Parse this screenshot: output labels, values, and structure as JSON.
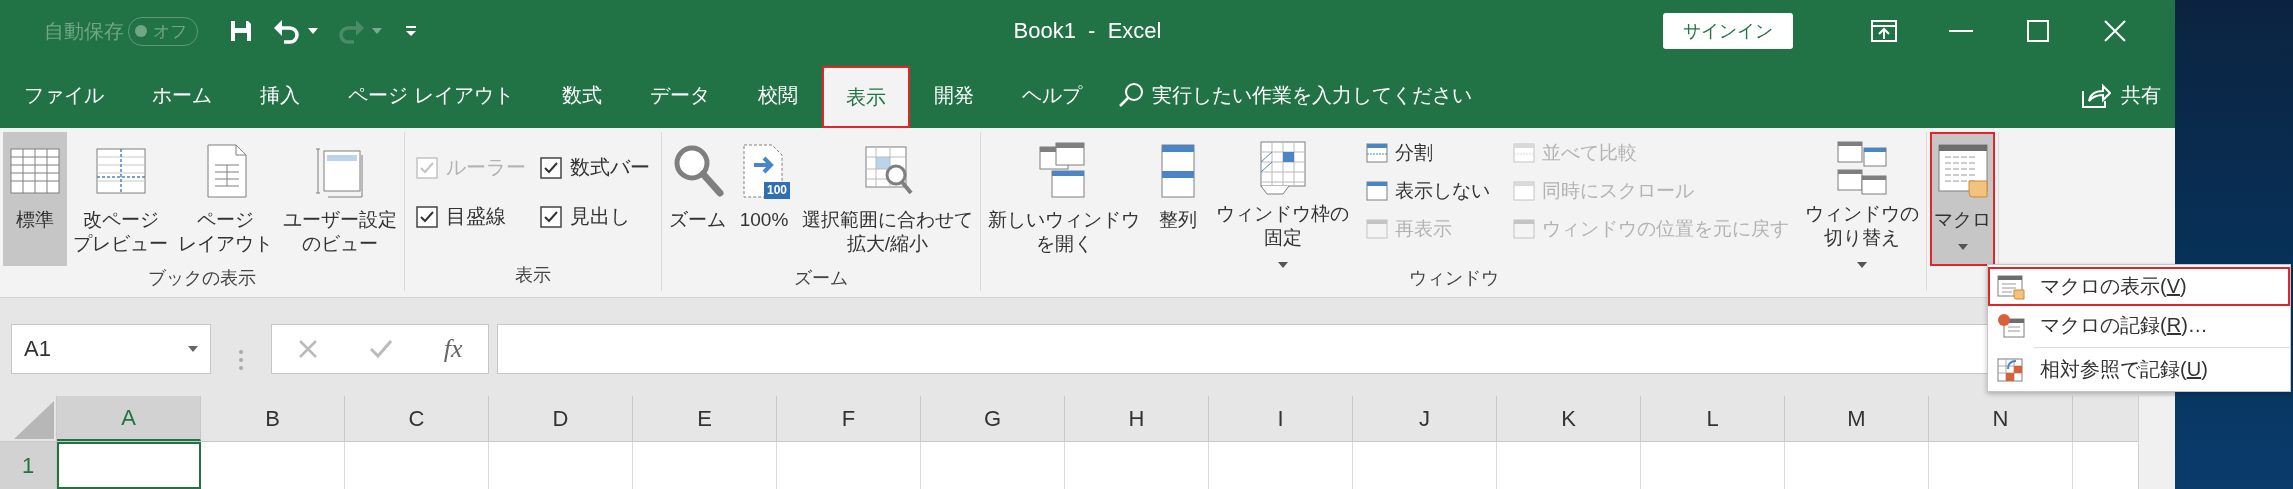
{
  "title_bar": {
    "autosave": {
      "label": "自動保存",
      "toggle": "オフ",
      "on": false
    },
    "quick_access": [
      {
        "kind": "save"
      },
      {
        "kind": "undo",
        "disabled": false
      },
      {
        "kind": "redo",
        "disabled": true
      },
      {
        "kind": "customize"
      }
    ],
    "title": "Book1  -  Excel",
    "sign_in": "サインイン"
  },
  "tabs": [
    {
      "label": "ファイル",
      "selected": false,
      "highlighted": false
    },
    {
      "label": "ホーム",
      "selected": false,
      "highlighted": false
    },
    {
      "label": "挿入",
      "selected": false,
      "highlighted": false
    },
    {
      "label": "ページ レイアウト",
      "selected": false,
      "highlighted": false
    },
    {
      "label": "数式",
      "selected": false,
      "highlighted": false
    },
    {
      "label": "データ",
      "selected": false,
      "highlighted": false
    },
    {
      "label": "校閲",
      "selected": false,
      "highlighted": false
    },
    {
      "label": "表示",
      "selected": true,
      "highlighted": true
    },
    {
      "label": "開発",
      "selected": false,
      "highlighted": false
    },
    {
      "label": "ヘルプ",
      "selected": false,
      "highlighted": false
    }
  ],
  "tell_me": {
    "placeholder": "実行したい作業を入力してください"
  },
  "share": "共有",
  "ribbon": {
    "groups": [
      {
        "label": "ブックの表示",
        "items": [
          {
            "kind": "large",
            "lines": [
              "標準"
            ],
            "selected": true
          },
          {
            "kind": "large",
            "lines": [
              "改ページ",
              "プレビュー"
            ],
            "selected": false
          },
          {
            "kind": "large",
            "lines": [
              "ページ",
              "レイアウト"
            ],
            "selected": false
          },
          {
            "kind": "large",
            "lines": [
              "ユーザー設定",
              "のビュー"
            ],
            "selected": false
          }
        ]
      },
      {
        "label": "表示",
        "items": [
          {
            "kind": "checks",
            "items": [
              {
                "label": "ルーラー",
                "checked": true,
                "disabled": true
              },
              {
                "label": "数式バー",
                "checked": true,
                "disabled": false
              },
              {
                "label": "目盛線",
                "checked": true,
                "disabled": false
              },
              {
                "label": "見出し",
                "checked": true,
                "disabled": false
              }
            ]
          }
        ]
      },
      {
        "label": "ズーム",
        "items": [
          {
            "kind": "large",
            "lines": [
              "ズーム"
            ]
          },
          {
            "kind": "large",
            "lines": [
              "100%"
            ],
            "badge": "100"
          },
          {
            "kind": "large",
            "lines": [
              "選択範囲に合わせて",
              "拡大/縮小"
            ]
          }
        ]
      },
      {
        "label": "ウィンドウ",
        "items": [
          {
            "kind": "large",
            "lines": [
              "新しいウィンドウ",
              "を開く"
            ]
          },
          {
            "kind": "large",
            "lines": [
              "整列"
            ]
          },
          {
            "kind": "large",
            "lines": [
              "ウィンドウ枠の",
              "固定"
            ],
            "dropdown": true
          },
          {
            "kind": "small",
            "items": [
              {
                "label": "分割",
                "disabled": false
              },
              {
                "label": "表示しない",
                "disabled": false
              },
              {
                "label": "再表示",
                "disabled": true
              }
            ]
          },
          {
            "kind": "small",
            "items": [
              {
                "label": "並べて比較",
                "disabled": true
              },
              {
                "label": "同時にスクロール",
                "disabled": true
              },
              {
                "label": "ウィンドウの位置を元に戻す",
                "disabled": true
              }
            ]
          },
          {
            "kind": "large",
            "lines": [
              "ウィンドウの",
              "切り替え"
            ],
            "dropdown": true
          }
        ]
      },
      {
        "items": [
          {
            "kind": "large",
            "lines": [
              "マクロ"
            ],
            "dropdown": true,
            "expanded": true,
            "highlighted": true
          }
        ]
      }
    ]
  },
  "formula_bar": {
    "name_box": "A1",
    "function_label": "fx"
  },
  "sheet": {
    "columns": [
      {
        "label": "A",
        "selected": true
      },
      {
        "label": "B",
        "selected": false
      },
      {
        "label": "C",
        "selected": false
      },
      {
        "label": "D",
        "selected": false
      },
      {
        "label": "E",
        "selected": false
      },
      {
        "label": "F",
        "selected": false
      },
      {
        "label": "G",
        "selected": false
      },
      {
        "label": "H",
        "selected": false
      },
      {
        "label": "I",
        "selected": false
      },
      {
        "label": "J",
        "selected": false
      },
      {
        "label": "K",
        "selected": false
      },
      {
        "label": "L",
        "selected": false
      },
      {
        "label": "M",
        "selected": false
      },
      {
        "label": "N",
        "selected": false
      }
    ],
    "rows": [
      {
        "label": "1",
        "selected": true
      }
    ]
  },
  "macro_menu": [
    {
      "kind": "view",
      "text": "マクロの表示(",
      "key": "V",
      "after": ")",
      "highlighted": true
    },
    {
      "kind": "record",
      "text": "マクロの記録(",
      "key": "R",
      "after": ")…",
      "highlighted": false
    },
    {
      "kind": "relative",
      "text": "相対参照で記録(",
      "key": "U",
      "after": ")",
      "highlighted": false
    }
  ]
}
